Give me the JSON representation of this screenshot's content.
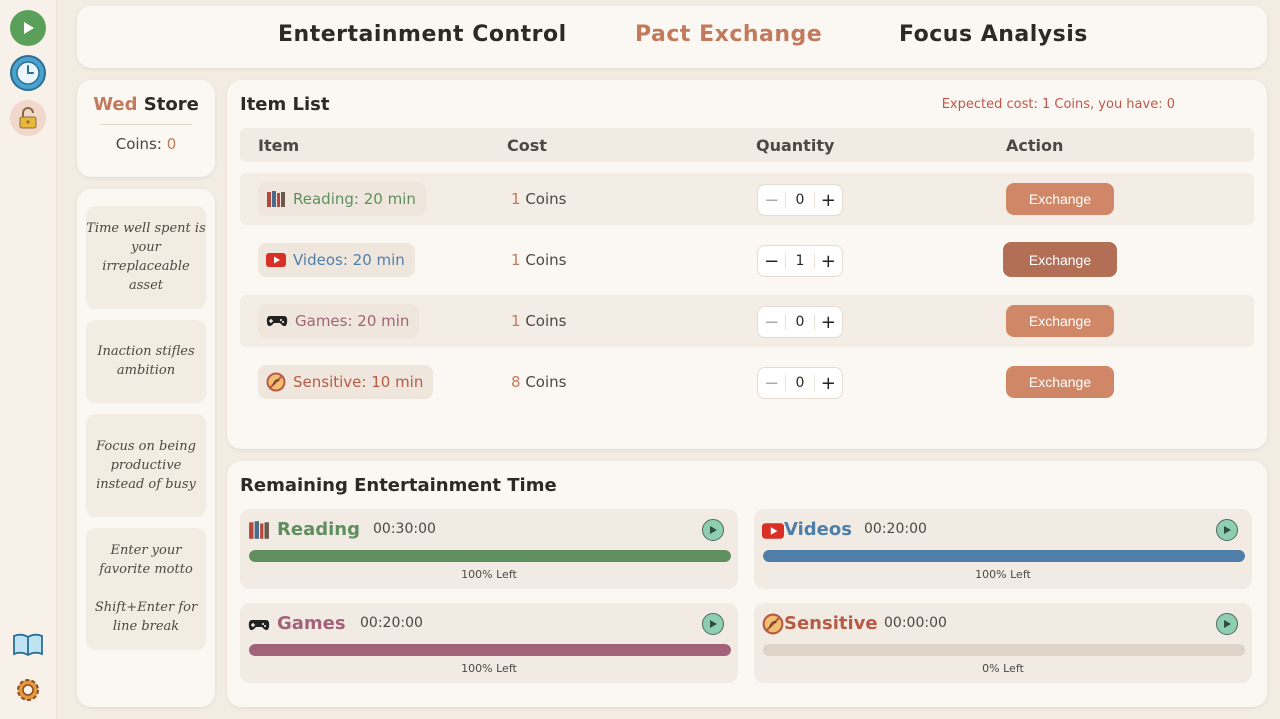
{
  "rail": {
    "top": [
      "play-icon",
      "clock-icon",
      "lock-icon"
    ],
    "bottom": [
      "book-icon",
      "gear-icon"
    ]
  },
  "tabs": [
    {
      "label": "Entertainment Control",
      "active": false
    },
    {
      "label": "Pact Exchange",
      "active": true
    },
    {
      "label": "Focus Analysis",
      "active": false
    }
  ],
  "store": {
    "day": "Wed",
    "title": "Store",
    "coins_label": "Coins:",
    "coins_value": "0"
  },
  "mottos": [
    "Time well spent is your irreplaceable asset",
    "Inaction stifles ambition",
    "Focus on being productive instead of busy",
    "Enter your favorite motto\n\nShift+Enter for line break"
  ],
  "item_list": {
    "title": "Item List",
    "expected": "Expected cost: 1 Coins, you have: 0",
    "headers": [
      "Item",
      "Cost",
      "Quantity",
      "Action"
    ],
    "rows": [
      {
        "icon": "books-icon",
        "label": "Reading: 20 min",
        "color": "#5f8f5f",
        "cost_num": "1",
        "cost_unit": "Coins",
        "qty": "0",
        "action": "Exchange"
      },
      {
        "icon": "video-icon",
        "label": "Videos: 20 min",
        "color": "#4f7fa8",
        "cost_num": "1",
        "cost_unit": "Coins",
        "qty": "1",
        "action": "Exchange"
      },
      {
        "icon": "gamepad-icon",
        "label": "Games: 20 min",
        "color": "#a2637a",
        "cost_num": "1",
        "cost_unit": "Coins",
        "qty": "0",
        "action": "Exchange"
      },
      {
        "icon": "sensitive-icon",
        "label": "Sensitive: 10 min",
        "color": "#b85b45",
        "cost_num": "8",
        "cost_unit": "Coins",
        "qty": "0",
        "action": "Exchange"
      }
    ]
  },
  "remaining": {
    "title": "Remaining Entertainment Time",
    "cards": [
      {
        "name": "Reading",
        "time": "00:30:00",
        "left": "100% Left",
        "fraction": 1.0,
        "color": "#5f8f5f"
      },
      {
        "name": "Videos",
        "time": "00:20:00",
        "left": "100% Left",
        "fraction": 1.0,
        "color": "#4f7fa8"
      },
      {
        "name": "Games",
        "time": "00:20:00",
        "left": "100% Left",
        "fraction": 1.0,
        "color": "#a2637a"
      },
      {
        "name": "Sensitive",
        "time": "00:00:00",
        "left": "0% Left",
        "fraction": 0.0,
        "color": "#b85b45"
      }
    ]
  }
}
